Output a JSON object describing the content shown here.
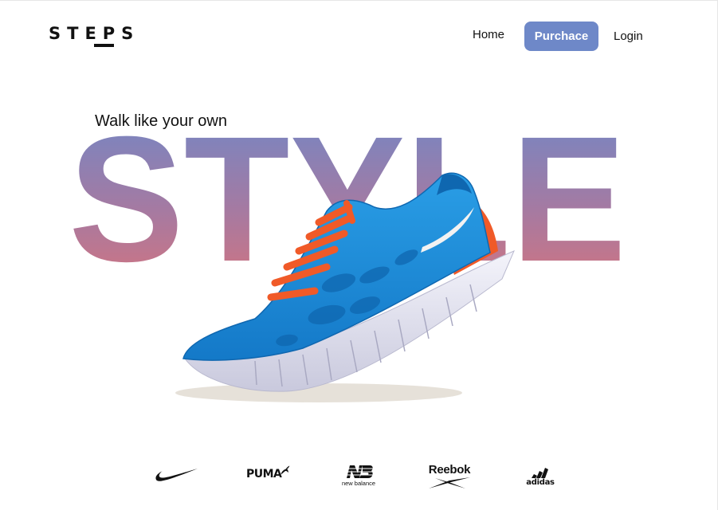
{
  "header": {
    "logo_text": "STEPS",
    "nav": {
      "home_label": "Home",
      "purchase_label": "Purchace",
      "login_label": "Login"
    }
  },
  "hero": {
    "tagline": "Walk like your own",
    "headline": "STYLE",
    "shoe_image": "blue-running-shoe-orange-laces",
    "gradient_top": "#6e88c8",
    "gradient_bottom": "#d8737b"
  },
  "brands": [
    {
      "name": "nike-logo",
      "text": ""
    },
    {
      "name": "puma-logo",
      "text": "PUMA"
    },
    {
      "name": "new-balance-logo",
      "text": "new balance"
    },
    {
      "name": "reebok-logo",
      "text": "Reebok"
    },
    {
      "name": "adidas-logo",
      "text": "adidas"
    }
  ],
  "colors": {
    "accent": "#6e88c8",
    "shoe_blue": "#1e8fd6",
    "lace_orange": "#f05a28"
  }
}
